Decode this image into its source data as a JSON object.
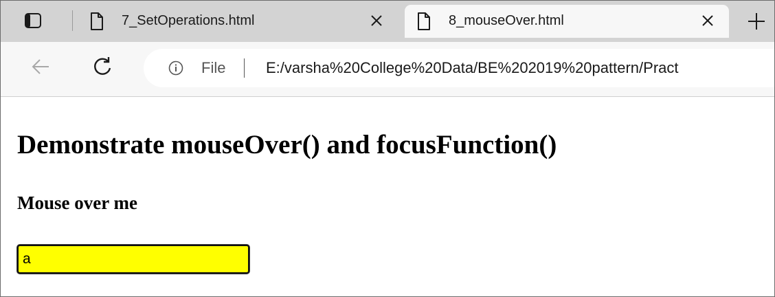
{
  "browser": {
    "tabs": [
      {
        "title": "7_SetOperations.html",
        "active": false,
        "icon": "document-icon"
      },
      {
        "title": "8_mouseOver.html",
        "active": true,
        "icon": "document-icon"
      }
    ],
    "address_bar": {
      "scheme_label": "File",
      "url": "E:/varsha%20College%20Data/BE%202019%20pattern/Pract"
    },
    "icons": {
      "tab_actions": "tab-actions-icon",
      "new_tab": "plus-icon",
      "back": "back-arrow-icon",
      "reload": "reload-icon",
      "info": "info-icon",
      "close": "close-icon"
    }
  },
  "page": {
    "heading": "Demonstrate mouseOver() and focusFunction()",
    "subheading": "Mouse over me",
    "input_value": "a",
    "input_background": "#ffff00"
  }
}
